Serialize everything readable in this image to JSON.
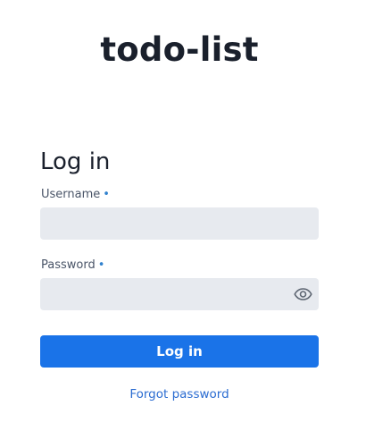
{
  "app": {
    "title": "todo-list"
  },
  "login_form": {
    "title": "Log in",
    "username": {
      "label": "Username",
      "required_marker": "•",
      "value": "",
      "placeholder": ""
    },
    "password": {
      "label": "Password",
      "required_marker": "•",
      "value": "",
      "placeholder": "",
      "toggle_icon": "eye-icon"
    },
    "submit_label": "Log in",
    "forgot_password_label": "Forgot password"
  },
  "colors": {
    "primary": "#1a73e8",
    "link": "#2b6cd1",
    "input_background": "#e7eaef",
    "required_marker": "#3182ce"
  }
}
